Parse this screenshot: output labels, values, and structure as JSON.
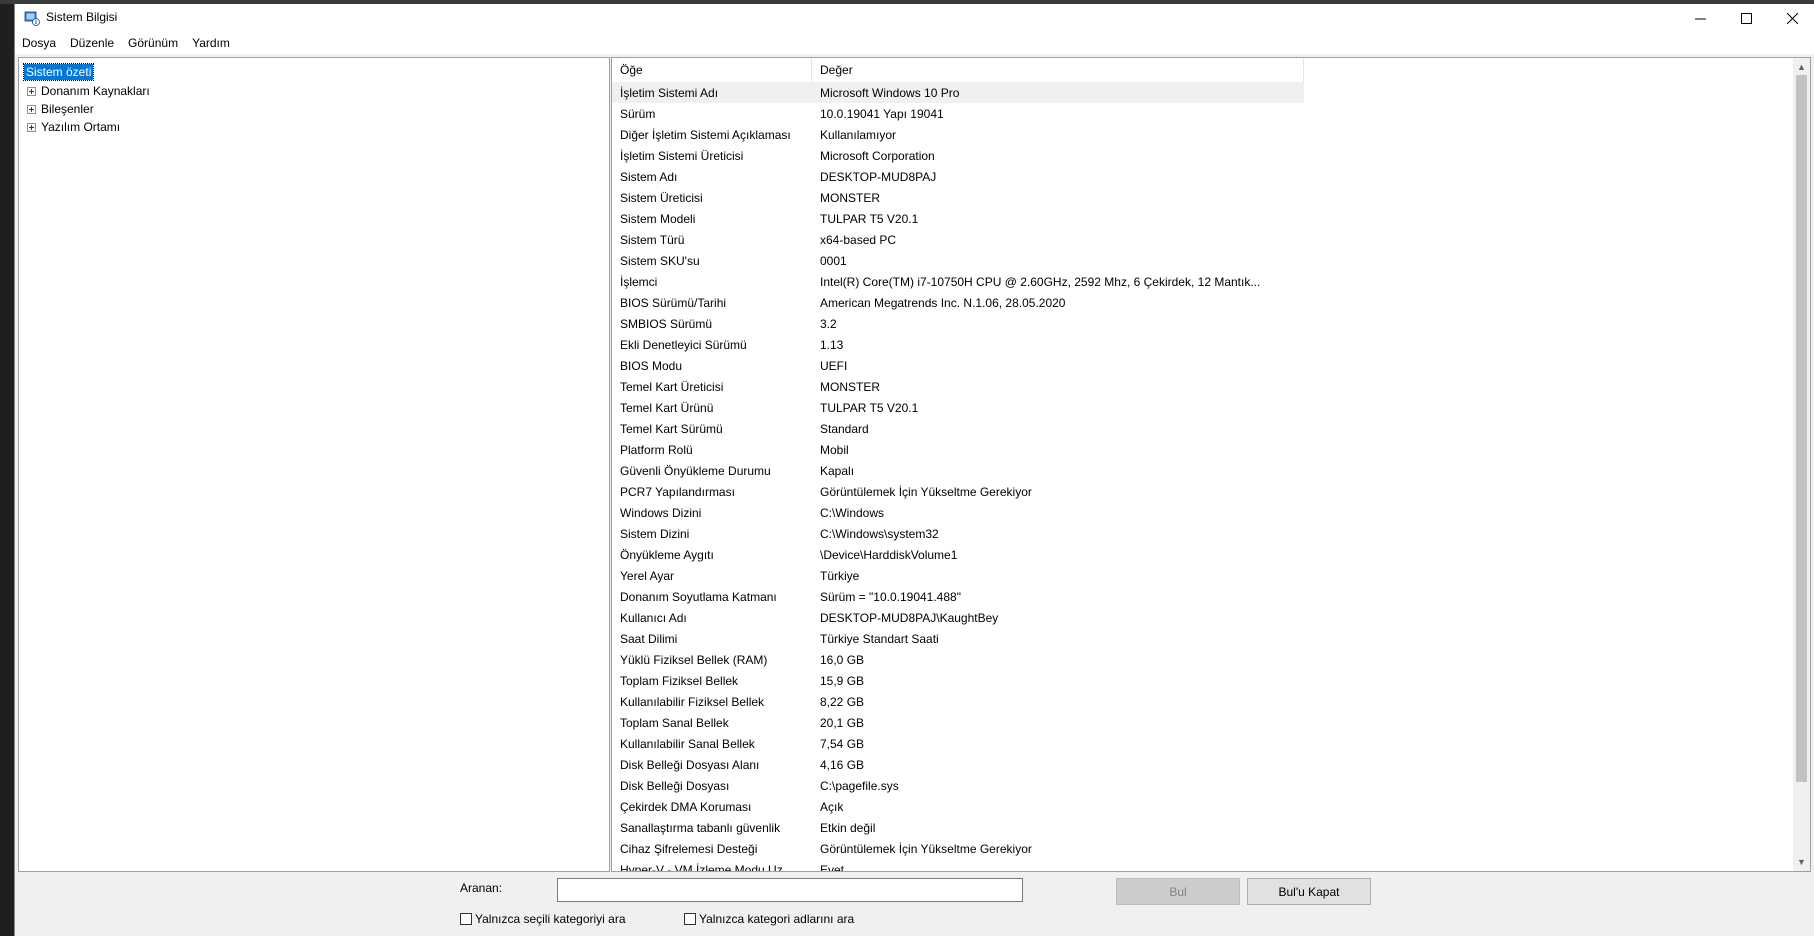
{
  "window": {
    "title": "Sistem Bilgisi",
    "controls": {
      "minimize": "—",
      "maximize": "☐",
      "close": "✕"
    }
  },
  "menu": [
    "Dosya",
    "Düzenle",
    "Görünüm",
    "Yardım"
  ],
  "tree": {
    "root": "Sistem özeti",
    "children": [
      "Donanım Kaynakları",
      "Bileşenler",
      "Yazılım Ortamı"
    ]
  },
  "list": {
    "headers": {
      "item": "Öğe",
      "value": "Değer"
    },
    "rows": [
      {
        "item": "İşletim Sistemi Adı",
        "value": "Microsoft Windows 10 Pro"
      },
      {
        "item": "Sürüm",
        "value": "10.0.19041 Yapı 19041"
      },
      {
        "item": "Diğer İşletim Sistemi Açıklaması",
        "value": "Kullanılamıyor"
      },
      {
        "item": "İşletim Sistemi Üreticisi",
        "value": "Microsoft Corporation"
      },
      {
        "item": "Sistem Adı",
        "value": "DESKTOP-MUD8PAJ"
      },
      {
        "item": "Sistem Üreticisi",
        "value": "MONSTER"
      },
      {
        "item": "Sistem Modeli",
        "value": "TULPAR T5 V20.1"
      },
      {
        "item": "Sistem Türü",
        "value": "x64-based PC"
      },
      {
        "item": "Sistem SKU'su",
        "value": "0001"
      },
      {
        "item": "İşlemci",
        "value": "Intel(R) Core(TM) i7-10750H CPU @ 2.60GHz, 2592 Mhz, 6 Çekirdek, 12 Mantık..."
      },
      {
        "item": "BIOS Sürümü/Tarihi",
        "value": "American Megatrends Inc. N.1.06, 28.05.2020"
      },
      {
        "item": "SMBIOS Sürümü",
        "value": "3.2"
      },
      {
        "item": "Ekli Denetleyici Sürümü",
        "value": "1.13"
      },
      {
        "item": "BIOS Modu",
        "value": "UEFI"
      },
      {
        "item": "Temel Kart Üreticisi",
        "value": "MONSTER"
      },
      {
        "item": "Temel Kart Ürünü",
        "value": "TULPAR T5 V20.1"
      },
      {
        "item": "Temel Kart Sürümü",
        "value": "Standard"
      },
      {
        "item": "Platform Rolü",
        "value": "Mobil"
      },
      {
        "item": "Güvenli Önyükleme Durumu",
        "value": "Kapalı"
      },
      {
        "item": "PCR7 Yapılandırması",
        "value": "Görüntülemek İçin Yükseltme Gerekiyor"
      },
      {
        "item": "Windows Dizini",
        "value": "C:\\Windows"
      },
      {
        "item": "Sistem Dizini",
        "value": "C:\\Windows\\system32"
      },
      {
        "item": "Önyükleme Aygıtı",
        "value": "\\Device\\HarddiskVolume1"
      },
      {
        "item": "Yerel Ayar",
        "value": "Türkiye"
      },
      {
        "item": "Donanım Soyutlama Katmanı",
        "value": "Sürüm = \"10.0.19041.488\""
      },
      {
        "item": "Kullanıcı Adı",
        "value": "DESKTOP-MUD8PAJ\\KaughtBey"
      },
      {
        "item": "Saat Dilimi",
        "value": "Türkiye Standart Saati"
      },
      {
        "item": "Yüklü Fiziksel Bellek (RAM)",
        "value": "16,0 GB"
      },
      {
        "item": "Toplam Fiziksel Bellek",
        "value": "15,9 GB"
      },
      {
        "item": "Kullanılabilir Fiziksel Bellek",
        "value": "8,22 GB"
      },
      {
        "item": "Toplam Sanal Bellek",
        "value": "20,1 GB"
      },
      {
        "item": "Kullanılabilir Sanal Bellek",
        "value": "7,54 GB"
      },
      {
        "item": "Disk Belleği Dosyası Alanı",
        "value": "4,16 GB"
      },
      {
        "item": "Disk Belleği Dosyası",
        "value": "C:\\pagefile.sys"
      },
      {
        "item": "Çekirdek DMA Koruması",
        "value": "Açık"
      },
      {
        "item": "Sanallaştırma tabanlı güvenlik",
        "value": "Etkin değil"
      },
      {
        "item": "Cihaz Şifrelemesi Desteği",
        "value": "Görüntülemek İçin Yükseltme Gerekiyor"
      },
      {
        "item": "Hyper-V - VM İzleme Modu Uz...",
        "value": "Evet"
      }
    ]
  },
  "search": {
    "label": "Aranan:",
    "value": "",
    "find_button": "Bul",
    "close_find_button": "Bul'u Kapat",
    "only_selected_category": "Yalnızca seçili kategoriyi ara",
    "only_category_names": "Yalnızca kategori adlarını ara"
  },
  "icons": {
    "app": "system-information-icon",
    "expander": "plus-box-icon",
    "scroll_up": "chevron-up-icon",
    "scroll_down": "chevron-down-icon"
  },
  "colors": {
    "selection": "#0078d7",
    "disabled_button_text": "#838383"
  }
}
